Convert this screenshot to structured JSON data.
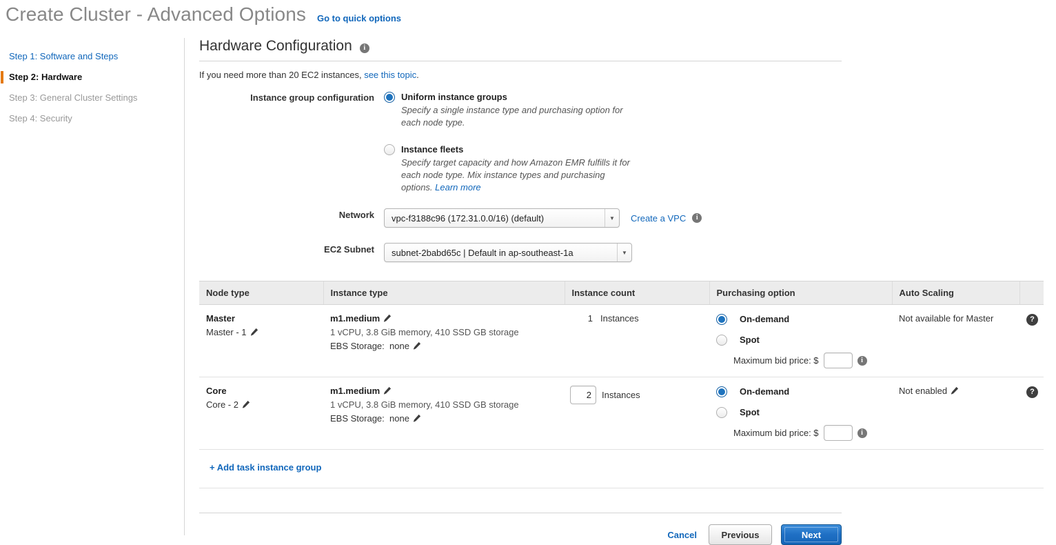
{
  "header": {
    "title": "Create Cluster - Advanced Options",
    "quick_options_link": "Go to quick options"
  },
  "sidebar": {
    "items": [
      {
        "label": "Step 1: Software and Steps",
        "state": "link"
      },
      {
        "label": "Step 2: Hardware",
        "state": "active"
      },
      {
        "label": "Step 3: General Cluster Settings",
        "state": "disabled"
      },
      {
        "label": "Step 4: Security",
        "state": "disabled"
      }
    ],
    "accent_color": "#e47911"
  },
  "main": {
    "section_title": "Hardware Configuration",
    "intro_prefix": "If you need more than 20 EC2 instances, ",
    "intro_link": "see this topic",
    "intro_suffix": ".",
    "instance_group": {
      "label": "Instance group configuration",
      "options": [
        {
          "title": "Uniform instance groups",
          "desc": "Specify a single instance type and purchasing option for each node type.",
          "selected": true
        },
        {
          "title": "Instance fleets",
          "desc": "Specify target capacity and how Amazon EMR fulfills it for each node type. Mix instance types and purchasing options. ",
          "desc_link": "Learn more",
          "selected": false
        }
      ]
    },
    "network": {
      "label": "Network",
      "value": "vpc-f3188c96 (172.31.0.0/16) (default)",
      "create_link": "Create a VPC"
    },
    "subnet": {
      "label": "EC2 Subnet",
      "value": "subnet-2babd65c | Default in ap-southeast-1a"
    }
  },
  "table": {
    "columns": [
      "Node type",
      "Instance type",
      "Instance count",
      "Purchasing option",
      "Auto Scaling",
      ""
    ],
    "rows": [
      {
        "node_type": "Master",
        "node_sub": "Master - 1",
        "instance_type": "m1.medium",
        "instance_spec": "1 vCPU, 3.8 GiB memory, 410 SSD GB storage",
        "ebs_label": "EBS Storage:",
        "ebs_value": "none",
        "count_value": "1",
        "count_editable": false,
        "count_label": "Instances",
        "purchase_options": [
          {
            "label": "On-demand",
            "selected": true
          },
          {
            "label": "Spot",
            "selected": false
          }
        ],
        "bid_label": "Maximum bid price: $",
        "bid_value": "",
        "autoscaling": "Not available for Master",
        "autoscaling_editable": false
      },
      {
        "node_type": "Core",
        "node_sub": "Core - 2",
        "instance_type": "m1.medium",
        "instance_spec": "1 vCPU, 3.8 GiB memory, 410 SSD GB storage",
        "ebs_label": "EBS Storage:",
        "ebs_value": "none",
        "count_value": "2",
        "count_editable": true,
        "count_label": "Instances",
        "purchase_options": [
          {
            "label": "On-demand",
            "selected": true
          },
          {
            "label": "Spot",
            "selected": false
          }
        ],
        "bid_label": "Maximum bid price: $",
        "bid_value": "",
        "autoscaling": "Not enabled",
        "autoscaling_editable": true
      }
    ],
    "add_task_link": "+ Add task instance group"
  },
  "footer": {
    "cancel": "Cancel",
    "previous": "Previous",
    "next": "Next"
  },
  "colors": {
    "link": "#1167bb",
    "accent_orange": "#e47911",
    "radio_selected": "#1e73be",
    "primary_button": "#1f6fc4"
  }
}
